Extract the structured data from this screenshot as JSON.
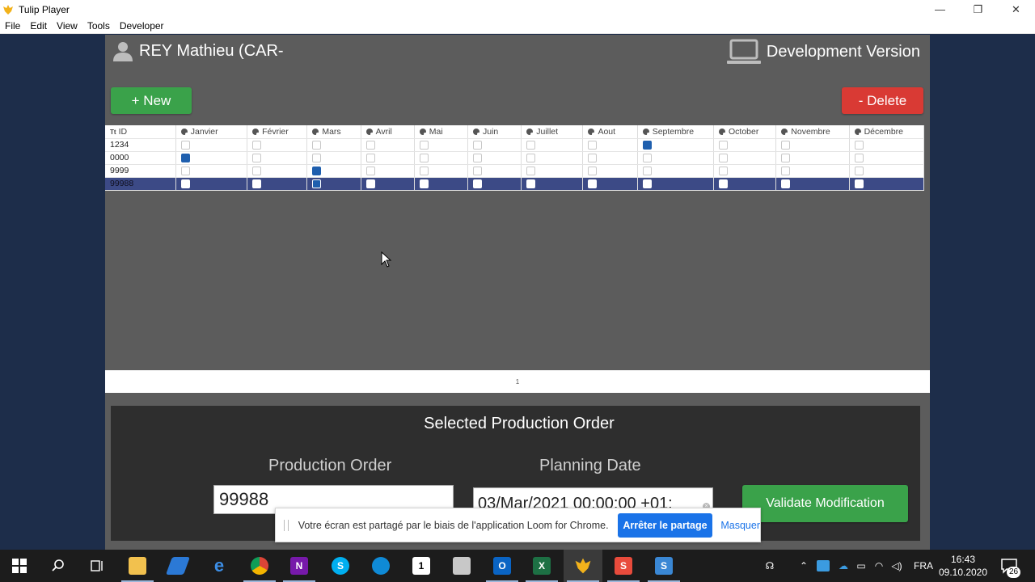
{
  "window": {
    "title": "Tulip Player",
    "controls": {
      "minimize": "—",
      "maximize": "❐",
      "close": "✕"
    }
  },
  "menu": [
    "File",
    "Edit",
    "View",
    "Tools",
    "Developer"
  ],
  "header": {
    "user_name": "REY Mathieu (CAR-",
    "version_label": "Development Version"
  },
  "buttons": {
    "new": "+ New",
    "delete": "- Delete",
    "validate": "Validate Modification"
  },
  "table": {
    "columns": [
      "ID",
      "Janvier",
      "Février",
      "Mars",
      "Avril",
      "Mai",
      "Juin",
      "Juillet",
      "Aout",
      "Septembre",
      "October",
      "Novembre",
      "Décembre"
    ],
    "rows": [
      {
        "id": "1234",
        "checked": [
          false,
          false,
          false,
          false,
          false,
          false,
          false,
          false,
          true,
          false,
          false,
          false
        ],
        "selected": false
      },
      {
        "id": "0000",
        "checked": [
          true,
          false,
          false,
          false,
          false,
          false,
          false,
          false,
          false,
          false,
          false,
          false
        ],
        "selected": false
      },
      {
        "id": "9999",
        "checked": [
          false,
          false,
          true,
          false,
          false,
          false,
          false,
          false,
          false,
          false,
          false,
          false
        ],
        "selected": false
      },
      {
        "id": "99988",
        "checked": [
          false,
          false,
          true,
          false,
          false,
          false,
          false,
          false,
          false,
          false,
          false,
          false
        ],
        "selected": true
      }
    ],
    "page": "1"
  },
  "panel": {
    "title": "Selected Production Order",
    "production_order_label": "Production Order",
    "production_order_value": "99988",
    "planning_date_label": "Planning Date",
    "planning_date_value": "03/Mar/2021 00:00:00 +01:"
  },
  "loom_bar": {
    "message": "Votre écran est partagé par le biais de l'application Loom for Chrome.",
    "stop": "Arrêter le partage",
    "hide": "Masquer"
  },
  "taskbar": {
    "icons": [
      "windows-start-icon",
      "search-icon",
      "task-view-icon",
      "file-explorer-icon",
      "sticky-notes-icon",
      "edge-icon",
      "chrome-icon",
      "onenote-icon",
      "skype-icon",
      "onedrive-app-icon",
      "tulip-app-icon",
      "snipping-icon",
      "outlook-icon",
      "excel-icon",
      "tulip-player-icon",
      "snagit-editor-icon",
      "snagit-icon"
    ],
    "language": "FRA",
    "time": "16:43",
    "date": "09.10.2020",
    "notifications": "26"
  },
  "colors": {
    "app_bg": "#5c5c5c",
    "desktop_bg": "#1d2d4a",
    "green": "#3aa24a",
    "red": "#d93a34",
    "selected_row": "#3c4a86",
    "checkbox_on": "#1f5fae"
  }
}
